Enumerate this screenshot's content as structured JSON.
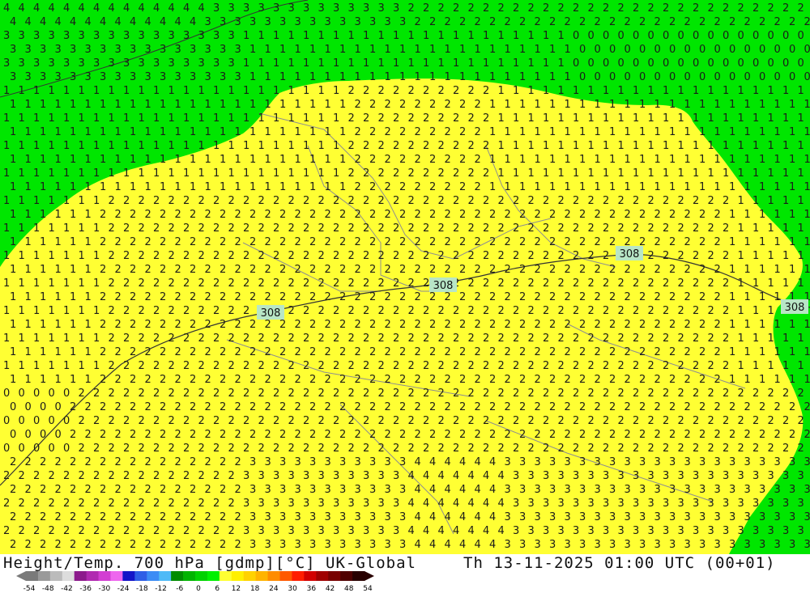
{
  "map": {
    "contour_labels": [
      "308",
      "308",
      "308",
      "308"
    ],
    "colors": {
      "cold": "#00e600",
      "warm": "#ffff33",
      "digit": "#1a1a1a",
      "border": "#8f8f8f",
      "contour": "#333333",
      "label_bg": "#b8e6c6"
    }
  },
  "footer": {
    "title_left": "Height/Temp. 700 hPa [gdmp][°C] UK-Global",
    "title_right": "Th 13-11-2025 01:00 UTC (00+01)"
  },
  "colorbar": {
    "ticks": [
      "-54",
      "-48",
      "-42",
      "-36",
      "-30",
      "-24",
      "-18",
      "-12",
      "-6",
      "0",
      "6",
      "12",
      "18",
      "24",
      "30",
      "36",
      "42",
      "48",
      "54"
    ],
    "colors": [
      "#7a7a7a",
      "#9a9a9a",
      "#bbbbbb",
      "#dddddd",
      "#8c1a8c",
      "#b02ab0",
      "#d23ed2",
      "#ee66ee",
      "#1414c8",
      "#2e5ee6",
      "#3c8cf5",
      "#4ebaf7",
      "#008c00",
      "#00b400",
      "#00d200",
      "#00f000",
      "#ffff33",
      "#fff000",
      "#ffd200",
      "#ffb400",
      "#ff8c00",
      "#ff5a00",
      "#ff1e00",
      "#d20000",
      "#a00000",
      "#780000",
      "#500000",
      "#280000"
    ]
  }
}
